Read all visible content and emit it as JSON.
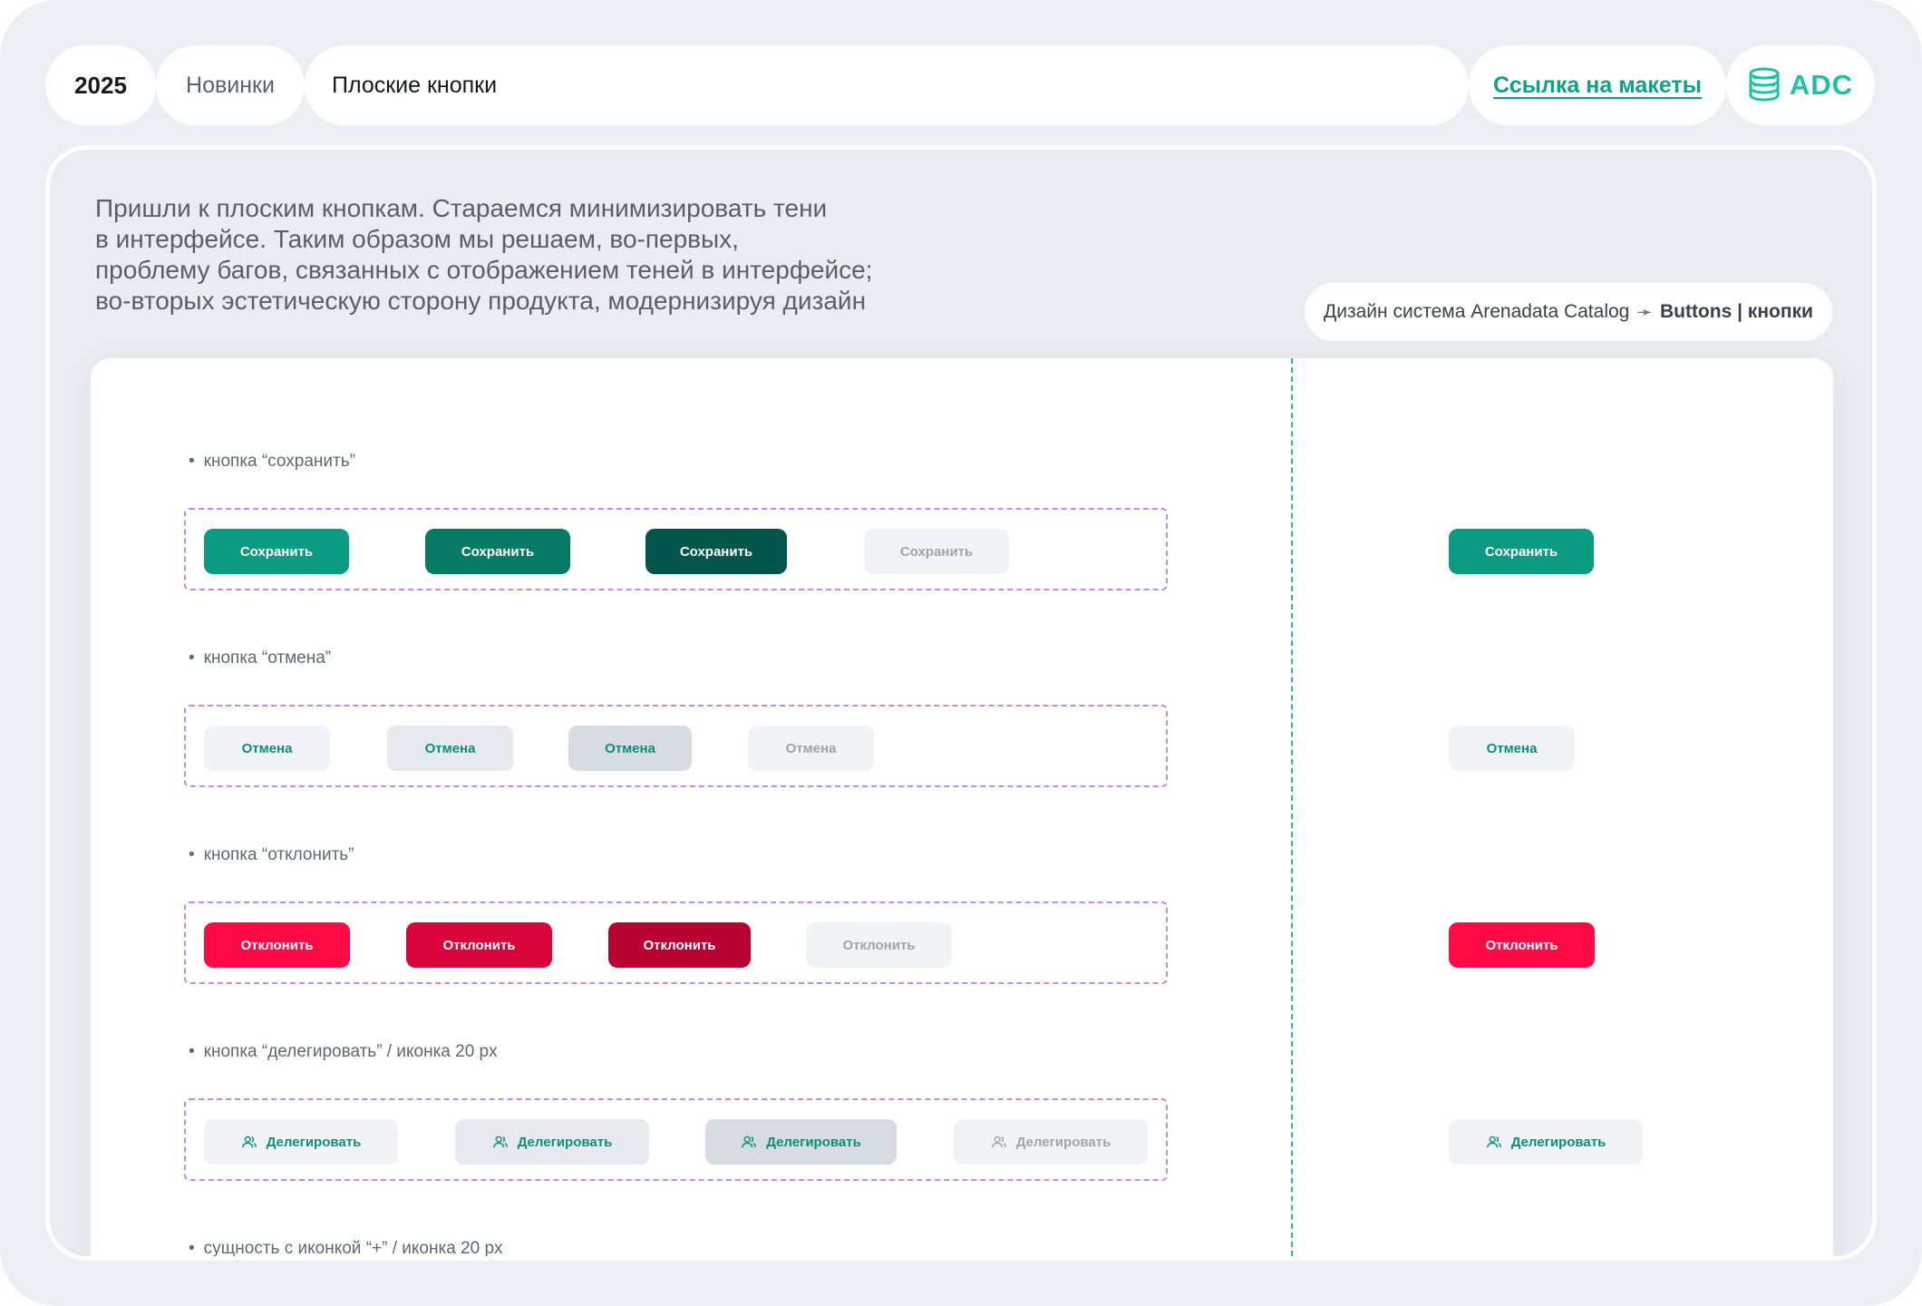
{
  "header": {
    "year": "2025",
    "section": "Новинки",
    "title": "Плоские кнопки",
    "link_label": "Ссылка на макеты",
    "logo_text": "ADC",
    "accent_color": "#0fa28a"
  },
  "intro": {
    "line1": "Пришли к плоским кнопкам. Стараемся минимизировать тени",
    "line2": "в интерфейсе. Таким образом мы решаем, во-первых,",
    "line3": "проблему багов, связанных с отображением теней в интерфейсе;",
    "line4": "во-вторых эстетическую сторону продукта, модернизируя дизайн"
  },
  "breadcrumb": {
    "part1": "Дизайн система Arenadata Catalog",
    "arrow": "➛",
    "part2": "Buttons | кнопки"
  },
  "sections": {
    "save": {
      "label": "кнопка “сохранить”",
      "button_label": "Сохранить",
      "colors": [
        "#0b9a82",
        "#077a66",
        "#02554a",
        "#f1f3f7"
      ]
    },
    "cancel": {
      "label": "кнопка “отмена”",
      "button_label": "Отмена"
    },
    "reject": {
      "label": "кнопка “отклонить”",
      "button_label": "Отклонить",
      "colors": [
        "#ff0a45",
        "#d9053a",
        "#b80130",
        "#f1f3f7"
      ]
    },
    "delegate": {
      "label": "кнопка “делегировать” / иконка 20 px",
      "button_label": "Делегировать",
      "icon": "users-icon"
    },
    "entity": {
      "label": "сущность с иконкой “+” / иконка 20 px"
    }
  }
}
